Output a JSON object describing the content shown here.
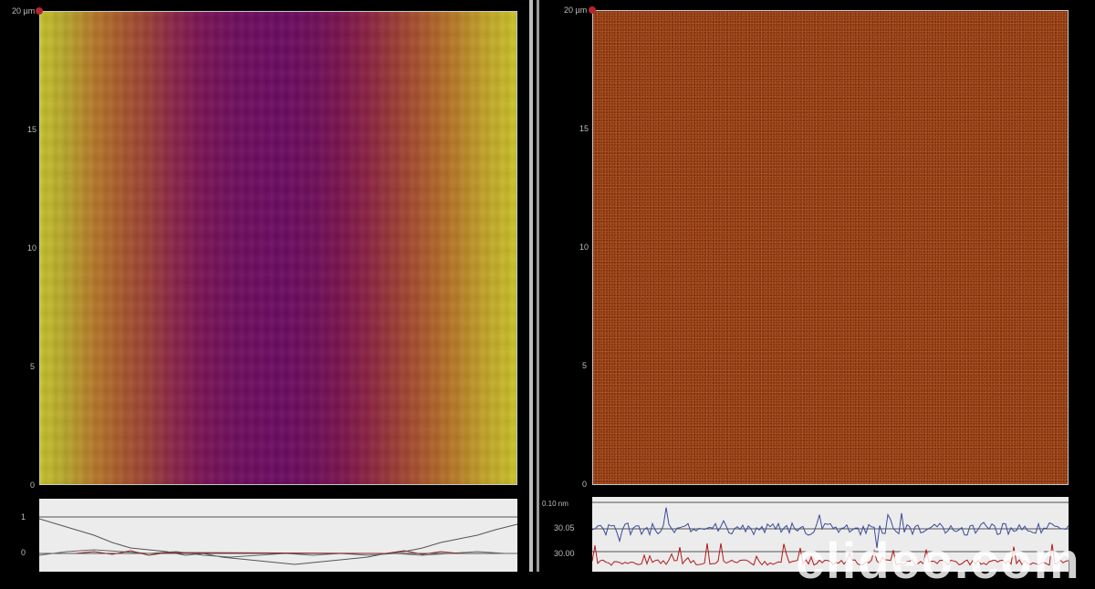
{
  "left_panel": {
    "axis": {
      "top_label": "20 µm",
      "ticks": [
        "15",
        "10",
        "5",
        "0"
      ]
    },
    "profile": {
      "ticks": [
        "1",
        "0"
      ]
    }
  },
  "right_panel": {
    "axis": {
      "top_label": "20 µm",
      "ticks": [
        "15",
        "10",
        "5",
        "0"
      ]
    },
    "profile": {
      "unit": "0.10 nm",
      "ticks": [
        "30.05",
        "30.00"
      ]
    }
  },
  "watermark": "clideo.com",
  "colors": {
    "background": "#000000",
    "left_colormap": [
      "#cbc42a",
      "#b77c2a",
      "#8b2648",
      "#6b0c63",
      "#8d2443",
      "#b87b28",
      "#cbc42a"
    ],
    "right_surface": "#8f3a12",
    "marker": "#b3262b",
    "profile_line_dark": "#555555",
    "profile_line_blue": "#3a4a9a",
    "profile_line_red": "#b01818"
  }
}
